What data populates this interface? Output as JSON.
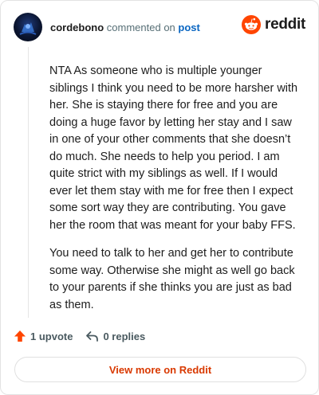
{
  "header": {
    "username": "cordebono",
    "commented_on": "commented on",
    "post_link": "post",
    "brand": "reddit"
  },
  "comment": {
    "paragraphs": [
      "NTA As someone who is multiple younger siblings I think you need to be more harsher with her. She is staying there for free and you are doing a huge favor by letting her stay and I saw in one of your other comments that she doesn’t do much. She needs to help you period. I am quite strict with my siblings as well. If I would ever let them stay with me for free then I expect some sort way they are contributing. You gave her the room that was meant for your baby FFS.",
      "You need to talk to her and get her to contribute some way. Otherwise she might as well go back to your parents if she thinks you are just as bad as them."
    ]
  },
  "actions": {
    "upvote": "1 upvote",
    "replies": "0 replies"
  },
  "footer": {
    "view_more": "View more on Reddit"
  },
  "colors": {
    "reddit_orange": "#ff4500",
    "link_blue": "#0a66c2",
    "view_more_text": "#d93900"
  },
  "icons": {
    "avatar": "user-avatar",
    "brand": "reddit-snoo-icon",
    "upvote": "upvote-arrow-icon",
    "reply": "reply-arrow-icon"
  }
}
